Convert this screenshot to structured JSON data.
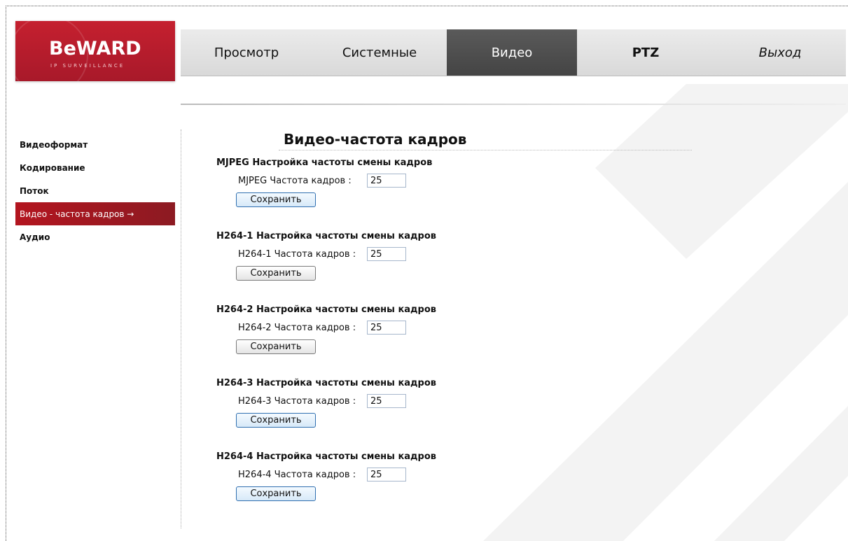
{
  "header": {
    "logo_text": "BeWARD",
    "logo_sub": "IP SURVEILLANCE",
    "nav": [
      {
        "label": "Просмотр"
      },
      {
        "label": "Системные"
      },
      {
        "label": "Видео"
      },
      {
        "label": "PTZ"
      },
      {
        "label": "Выход"
      }
    ]
  },
  "sidebar": {
    "items": [
      {
        "label": "Видеоформат"
      },
      {
        "label": "Кодирование"
      },
      {
        "label": "Поток"
      },
      {
        "label": "Видео - частота кадров →"
      },
      {
        "label": "Аудио"
      }
    ]
  },
  "main": {
    "title": "Видео-частота кадров",
    "sections": [
      {
        "title": "MJPEG Настройка частоты смены кадров",
        "label": "MJPEG Частота кадров :",
        "value": "25",
        "button": "Сохранить"
      },
      {
        "title": "H264-1 Настройка частоты смены кадров",
        "label": "H264-1 Частота кадров :",
        "value": "25",
        "button": "Сохранить"
      },
      {
        "title": "H264-2 Настройка частоты смены кадров",
        "label": "H264-2 Частота кадров :",
        "value": "25",
        "button": "Сохранить"
      },
      {
        "title": "H264-3 Настройка частоты смены кадров",
        "label": "H264-3 Частота кадров :",
        "value": "25",
        "button": "Сохранить"
      },
      {
        "title": "H264-4 Настройка частоты смены кадров",
        "label": "H264-4 Частота кадров :",
        "value": "25",
        "button": "Сохранить"
      }
    ]
  }
}
